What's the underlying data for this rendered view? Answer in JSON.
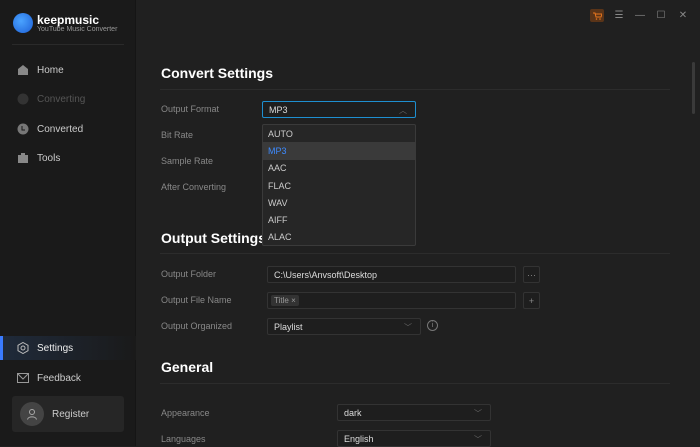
{
  "app": {
    "name": "keepmusic",
    "subtitle": "YouTube Music Converter"
  },
  "sidebar": {
    "items": [
      {
        "label": "Home"
      },
      {
        "label": "Converting"
      },
      {
        "label": "Converted"
      },
      {
        "label": "Tools"
      }
    ],
    "settings": "Settings",
    "feedback": "Feedback",
    "register": "Register"
  },
  "convert": {
    "title": "Convert Settings",
    "output_format_label": "Output Format",
    "output_format_value": "MP3",
    "bit_rate_label": "Bit Rate",
    "sample_rate_label": "Sample Rate",
    "after_label": "After Converting",
    "options": [
      "AUTO",
      "MP3",
      "AAC",
      "FLAC",
      "WAV",
      "AIFF",
      "ALAC"
    ],
    "selected": "MP3"
  },
  "output": {
    "title": "Output Settings",
    "folder_label": "Output Folder",
    "folder_value": "C:\\Users\\Anvsoft\\Desktop",
    "browse": "···",
    "filename_label": "Output File Name",
    "tag": "Title",
    "add": "+",
    "organized_label": "Output Organized",
    "organized_value": "Playlist"
  },
  "general": {
    "title": "General",
    "appearance_label": "Appearance",
    "appearance_value": "dark",
    "languages_label": "Languages",
    "languages_value": "English"
  },
  "colors": {
    "accent": "#3a7bff",
    "cart": "#e8761e"
  }
}
